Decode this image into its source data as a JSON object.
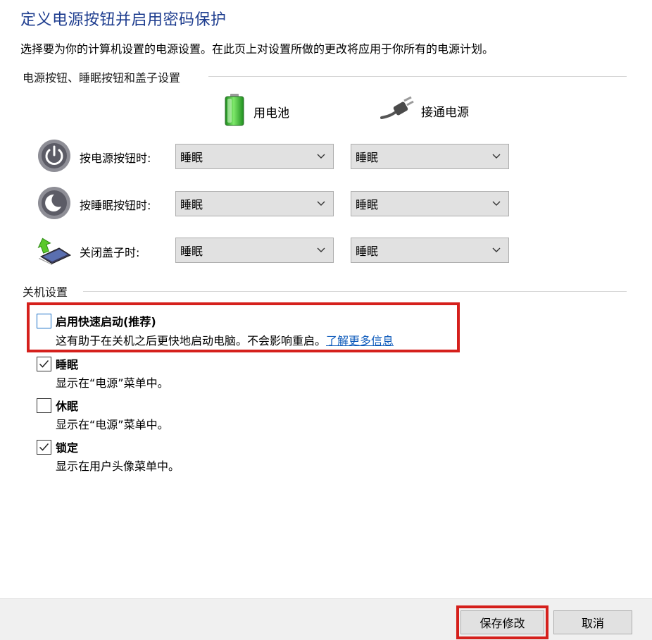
{
  "title": "定义电源按钮并启用密码保护",
  "description": "选择要为你的计算机设置的电源设置。在此页上对设置所做的更改将应用于你所有的电源计划。",
  "power_section": {
    "heading": "电源按钮、睡眠按钮和盖子设置",
    "col_battery": "用电池",
    "col_plugged": "接通电源",
    "rows": [
      {
        "label": "按电源按钮时:",
        "battery": "睡眠",
        "plugged": "睡眠",
        "icon": "power-button-icon"
      },
      {
        "label": "按睡眠按钮时:",
        "battery": "睡眠",
        "plugged": "睡眠",
        "icon": "sleep-button-icon"
      },
      {
        "label": "关闭盖子时:",
        "battery": "睡眠",
        "plugged": "睡眠",
        "icon": "laptop-lid-icon"
      }
    ]
  },
  "shutdown_section": {
    "heading": "关机设置",
    "items": [
      {
        "title": "启用快速启动(推荐)",
        "desc": "这有助于在关机之后更快地启动电脑。不会影响重启。",
        "link": "了解更多信息",
        "checked": false
      },
      {
        "title": "睡眠",
        "desc": "显示在“电源”菜单中。",
        "checked": true
      },
      {
        "title": "休眠",
        "desc": "显示在“电源”菜单中。",
        "checked": false
      },
      {
        "title": "锁定",
        "desc": "显示在用户头像菜单中。",
        "checked": true
      }
    ]
  },
  "footer": {
    "save_label": "保存修改",
    "cancel_label": "取消"
  },
  "colors": {
    "title": "#1e3d8f",
    "highlight": "#d5201c",
    "link": "#0a58ba"
  }
}
